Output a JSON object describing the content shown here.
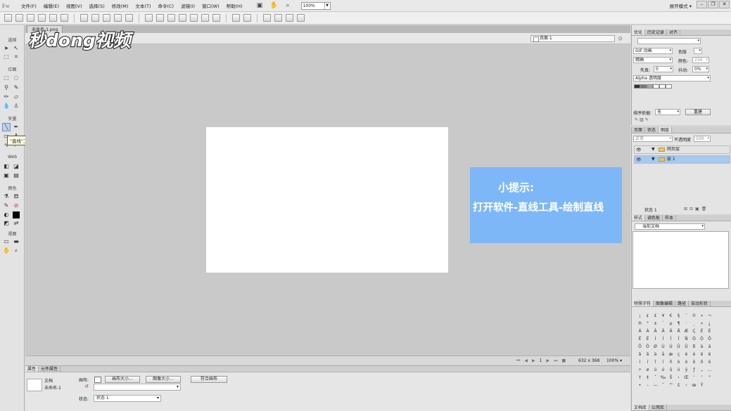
{
  "app": {
    "logo": "Fw",
    "menu": [
      "文件(F)",
      "编辑(E)",
      "视图(V)",
      "选择(S)",
      "修改(M)",
      "文本(T)",
      "命令(C)",
      "滤镜(I)",
      "窗口(W)",
      "帮助(H)"
    ],
    "zoom": "100%",
    "workspace": "展开模式",
    "win_min": "–",
    "win_restore": "❐",
    "win_close": "✕"
  },
  "tools": {
    "categories": [
      "选择",
      "位图",
      "矢量",
      "Web",
      "颜色",
      "视图"
    ],
    "tooltip": "\"直线\"工具 (N)"
  },
  "document": {
    "tab_label": "未命名-1.png",
    "page_selector": "页面 1",
    "status_page": "1",
    "status_size": "632 x 368",
    "status_zoom": "100%"
  },
  "tip": {
    "title": "小提示:",
    "text": "打开软件-直线工具-绘制直线"
  },
  "watermark": {
    "text": "秒dong视频"
  },
  "properties": {
    "tabs": [
      "属性",
      "元件属性"
    ],
    "doc_label": "文档",
    "doc_name": "未命名-1",
    "canvas_label": "画布:",
    "canvas_size_btn": "画布大小...",
    "image_size_btn": "图像大小...",
    "fit_canvas_btn": "符合画布",
    "state_label": "状态:",
    "state_value": "状态 1"
  },
  "optimize_panel": {
    "tabs": [
      "优化",
      "历史记录",
      "对齐"
    ],
    "format": "GIF 动画",
    "palette": "精确",
    "matte_label": "色版",
    "colors_label": "颜色:",
    "colors_value": "256",
    "loss_label": "失真:",
    "loss_value": "0",
    "dither_label": "抖动:",
    "dither_value": "0%",
    "transparency": "Alpha 透明度",
    "sort_label": "排序依据:",
    "sort_value": "无",
    "rebuild_btn": "重建"
  },
  "layers_panel": {
    "tabs": [
      "页面",
      "状态",
      "图层"
    ],
    "blend_mode": "正常",
    "opacity_label": "不透明度",
    "opacity_value": "100",
    "layers": [
      "网页层",
      "层 1"
    ],
    "state_footer": "状态 1"
  },
  "styles_panel": {
    "tabs": [
      "样式",
      "调色板",
      "样本"
    ],
    "library": "当前文档"
  },
  "special_chars_panel": {
    "tabs": [
      "特殊字符",
      "图像编辑",
      "路径",
      "自动形状"
    ],
    "chars": [
      "¡",
      "¢",
      "£",
      "¥",
      "€",
      "§",
      "¨",
      "©",
      "«",
      "¬",
      "®",
      "°",
      "±",
      "´",
      "µ",
      "¶",
      "·",
      "¸",
      "»",
      "¿",
      "À",
      "Á",
      "Â",
      "Ã",
      "Ä",
      "Å",
      "Æ",
      "Ç",
      "È",
      "É",
      "Ê",
      "Ë",
      "Ì",
      "Í",
      "Î",
      "Ï",
      "Ñ",
      "Ò",
      "Ó",
      "Ô",
      "Õ",
      "Ö",
      "Ø",
      "Ù",
      "Ú",
      "Û",
      "Ü",
      "ß",
      "à",
      "á",
      "â",
      "ã",
      "ä",
      "å",
      "æ",
      "ç",
      "è",
      "é",
      "ê",
      "ë",
      "ì",
      "í",
      "î",
      "ï",
      "ñ",
      "ò",
      "ó",
      "ô",
      "õ",
      "ö",
      "÷",
      "ø",
      "ù",
      "ú",
      "û",
      "ü",
      "ÿ",
      "ƒ",
      "„",
      "…",
      "†",
      "‡",
      "ˆ",
      "‰",
      "Š",
      "‹",
      "Œ",
      "'",
      "'",
      "\"",
      "•",
      "–",
      "—",
      "˜",
      "™",
      "š",
      "›",
      "œ",
      "Ÿ"
    ]
  },
  "bottom_tabs": [
    "文档库",
    "公用库"
  ],
  "colors": {
    "tip_bg": "#7db7f8",
    "canvas": "#ffffff",
    "workspace_bg": "#c9c9c9",
    "layer_selected": "#a8c8ef"
  }
}
